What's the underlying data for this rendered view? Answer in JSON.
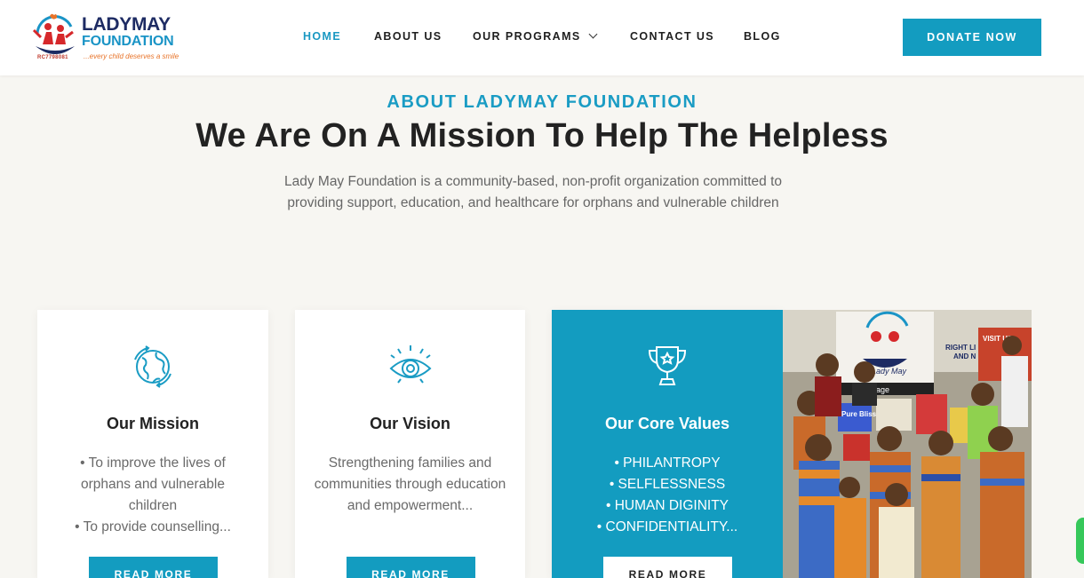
{
  "brand": {
    "name_line1": "LADYMAY",
    "name_line2": "FOUNDATION",
    "registration": "RC7798081",
    "tagline": "...every child deserves a smile",
    "primary_color": "#139cc0",
    "navy_color": "#1d2b63",
    "accent_orange": "#e8742a",
    "accent_red": "#d6282b"
  },
  "nav": {
    "items": [
      {
        "label": "HOME",
        "active": true
      },
      {
        "label": "ABOUT US",
        "active": false
      },
      {
        "label": "OUR PROGRAMS",
        "active": false,
        "dropdown": true
      },
      {
        "label": "CONTACT US",
        "active": false
      },
      {
        "label": "BLOG",
        "active": false
      }
    ],
    "donate_label": "DONATE NOW"
  },
  "about": {
    "eyebrow": "ABOUT LADYMAY FOUNDATION",
    "headline": "We Are On A Mission To Help The Helpless",
    "intro": "Lady May Foundation is a community-based, non-profit organization committed to providing support, education, and healthcare for orphans and vulnerable children"
  },
  "cards": [
    {
      "icon": "globe-icon",
      "title": "Our Mission",
      "text": "• To improve the lives of orphans and vulnerable children\n• To provide counselling...",
      "button": "READ MORE"
    },
    {
      "icon": "eye-icon",
      "title": "Our Vision",
      "text": "Strengthening families and communities through education and empowerment...",
      "button": "READ MORE"
    },
    {
      "icon": "trophy-icon",
      "title": "Our Core Values",
      "text": "• PHILANTROPY\n• SELFLESSNESS\n• HUMAN DIGINITY\n• CONFIDENTIALITY...",
      "button": "READ MORE"
    }
  ],
  "photo": {
    "banner_text": "Lady May",
    "sign_text": "VISIT US",
    "sign_text2": "RIGHT LI",
    "sign_text3": "AND N",
    "box_text1": "Pure Bliss",
    "box_text2": "nage"
  }
}
